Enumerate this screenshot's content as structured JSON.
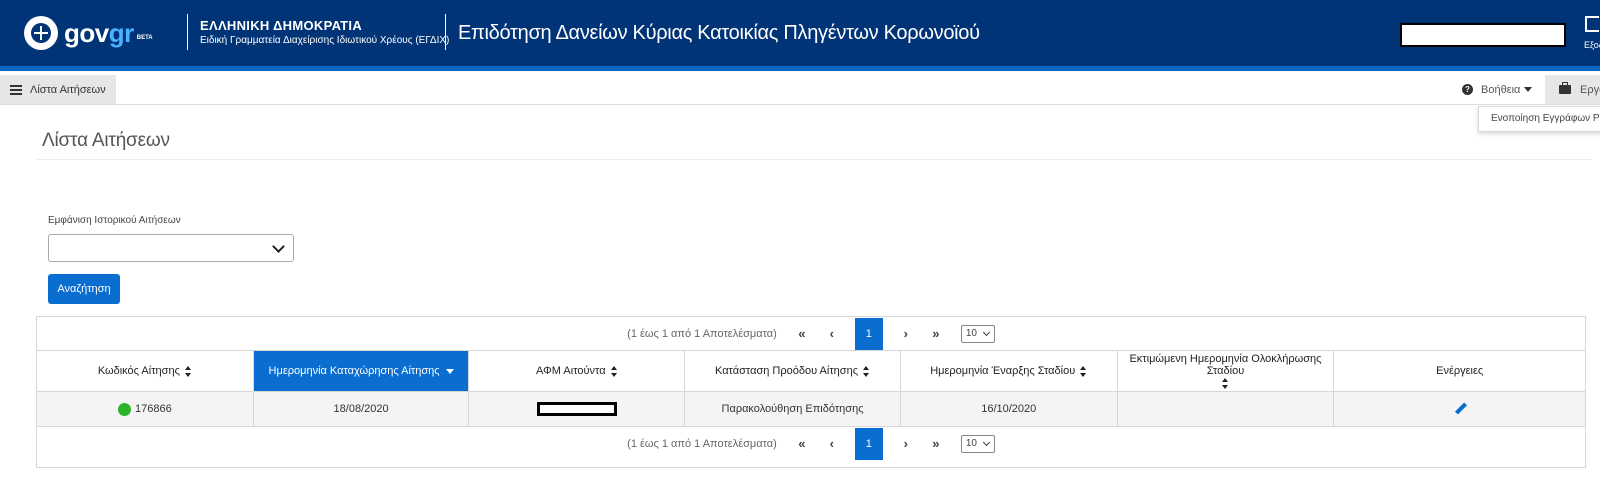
{
  "header": {
    "logo_text": "gov",
    "logo_text_accent": "gr",
    "logo_badge": "BETA",
    "org_title": "ΕΛΛΗΝΙΚΗ ΔΗΜΟΚΡΑΤΙΑ",
    "org_subtitle": "Ειδική Γραμματεία Διαχείρισης Ιδιωτικού Χρέους (ΕΓΔΙΧ)",
    "app_title": "Επιδότηση Δανείων Κύριας Κατοικίας Πληγέντων Κορωνοϊού",
    "user_name": "",
    "logout_label": "Εξοδ"
  },
  "toolbar": {
    "list_menu_label": "Λίστα Αιτήσεων",
    "help_label": "Βοήθεια",
    "tools_label": "Εργαλ",
    "dropdown_item": "Ενοποίηση Εγγράφων PDF"
  },
  "page": {
    "title": "Λίστα Αιτήσεων",
    "history_label": "Εμφάνιση Ιστορικού Αιτήσεων",
    "history_value": "",
    "search_button": "Αναζήτηση"
  },
  "paginator": {
    "report": "(1 έως 1 από 1 Αποτελέσματα)",
    "first": "«",
    "prev": "‹",
    "current_page": "1",
    "next": "›",
    "last": "»",
    "rows_per_page": "10"
  },
  "table": {
    "columns": [
      "Κωδικός Αίτησης",
      "Ημερομηνία Καταχώρησης Αίτησης",
      "ΑΦΜ Αιτούντα",
      "Κατάσταση Προόδου Αίτησης",
      "Ημερομηνία Έναρξης Σταδίου",
      "Εκτιμώμενη Ημερομηνία Ολοκλήρωσης Σταδίου",
      "Ενέργειες"
    ],
    "rows": [
      {
        "code": "176866",
        "registration_date": "18/08/2020",
        "afm": "",
        "status": "Παρακολούθηση Επιδότησης",
        "stage_start": "16/10/2020",
        "stage_end_estimate": "",
        "status_color": "#2ab42a"
      }
    ]
  },
  "colors": {
    "header_bg": "#003476",
    "accent": "#0a6ed1",
    "status_ok": "#2ab42a"
  }
}
